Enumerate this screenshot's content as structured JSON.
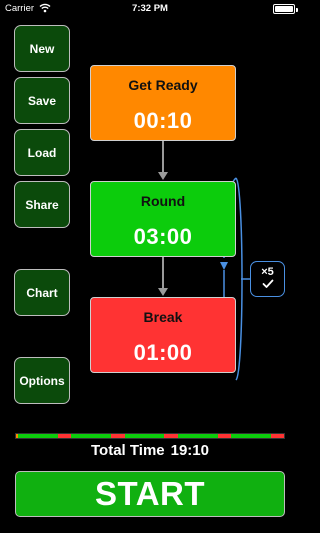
{
  "status_bar": {
    "carrier": "Carrier",
    "time": "7:32 PM",
    "wifi_icon": "wifi-icon",
    "battery_icon": "battery-icon"
  },
  "sidebar": {
    "buttons": [
      {
        "id": "new",
        "label": "New"
      },
      {
        "id": "save",
        "label": "Save"
      },
      {
        "id": "load",
        "label": "Load"
      },
      {
        "id": "share",
        "label": "Share"
      },
      {
        "id": "chart",
        "label": "Chart"
      },
      {
        "id": "options",
        "label": "Options"
      }
    ]
  },
  "phases": [
    {
      "name": "Get Ready",
      "time": "00:10",
      "color": "#ff8800"
    },
    {
      "name": "Round",
      "time": "03:00",
      "color": "#0ccc0c"
    },
    {
      "name": "Break",
      "time": "01:00",
      "color": "#ff3333"
    }
  ],
  "repeat": {
    "count_label": "×5",
    "check_icon": "checkmark-icon"
  },
  "colors": {
    "loop_arrow": "#4a90e2",
    "connector": "#9a9a9a",
    "button_bg": "#0b4a0b",
    "start_bg": "#10b010"
  },
  "total": {
    "label": "Total Time",
    "value": "19:10"
  },
  "start_button": {
    "label": "START"
  }
}
